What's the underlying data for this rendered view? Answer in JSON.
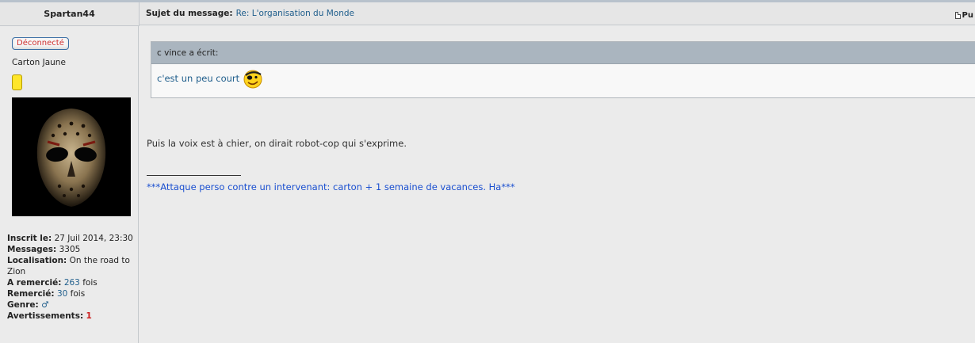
{
  "header": {
    "username": "Spartan44",
    "subject_label": "Sujet du message:",
    "subject_value": "Re: L'organisation du Monde",
    "post_link_text": "Pu"
  },
  "user": {
    "status": "Déconnecté",
    "rank": "Carton Jaune",
    "avatar_icon": "hockey-mask-avatar",
    "profile": {
      "inscrit_label": "Inscrit le:",
      "inscrit_value": "27 Juil 2014, 23:30",
      "messages_label": "Messages:",
      "messages_value": "3305",
      "localisation_label": "Localisation:",
      "localisation_value": "On the road to Zion",
      "a_remercie_label": "A remercié:",
      "a_remercie_count": "263",
      "a_remercie_suffix": "fois",
      "remercie_label": "Remercié:",
      "remercie_count": "30",
      "remercie_suffix": "fois",
      "genre_label": "Genre:",
      "genre_symbol": "♂",
      "avertissements_label": "Avertissements:",
      "avertissements_value": "1"
    }
  },
  "post": {
    "quote_author": "c vince a écrit:",
    "quote_text": "c'est un peu court",
    "body": "Puis la voix est à chier, on dirait robot-cop qui s'exprime.",
    "signature": "***Attaque perso contre un intervenant: carton + 1 semaine de vacances. Ha***"
  },
  "colors": {
    "link": "#1f5e8c",
    "status_red": "#d03030",
    "signature_blue": "#1a4fd0",
    "card_yellow": "#ffe62a"
  }
}
